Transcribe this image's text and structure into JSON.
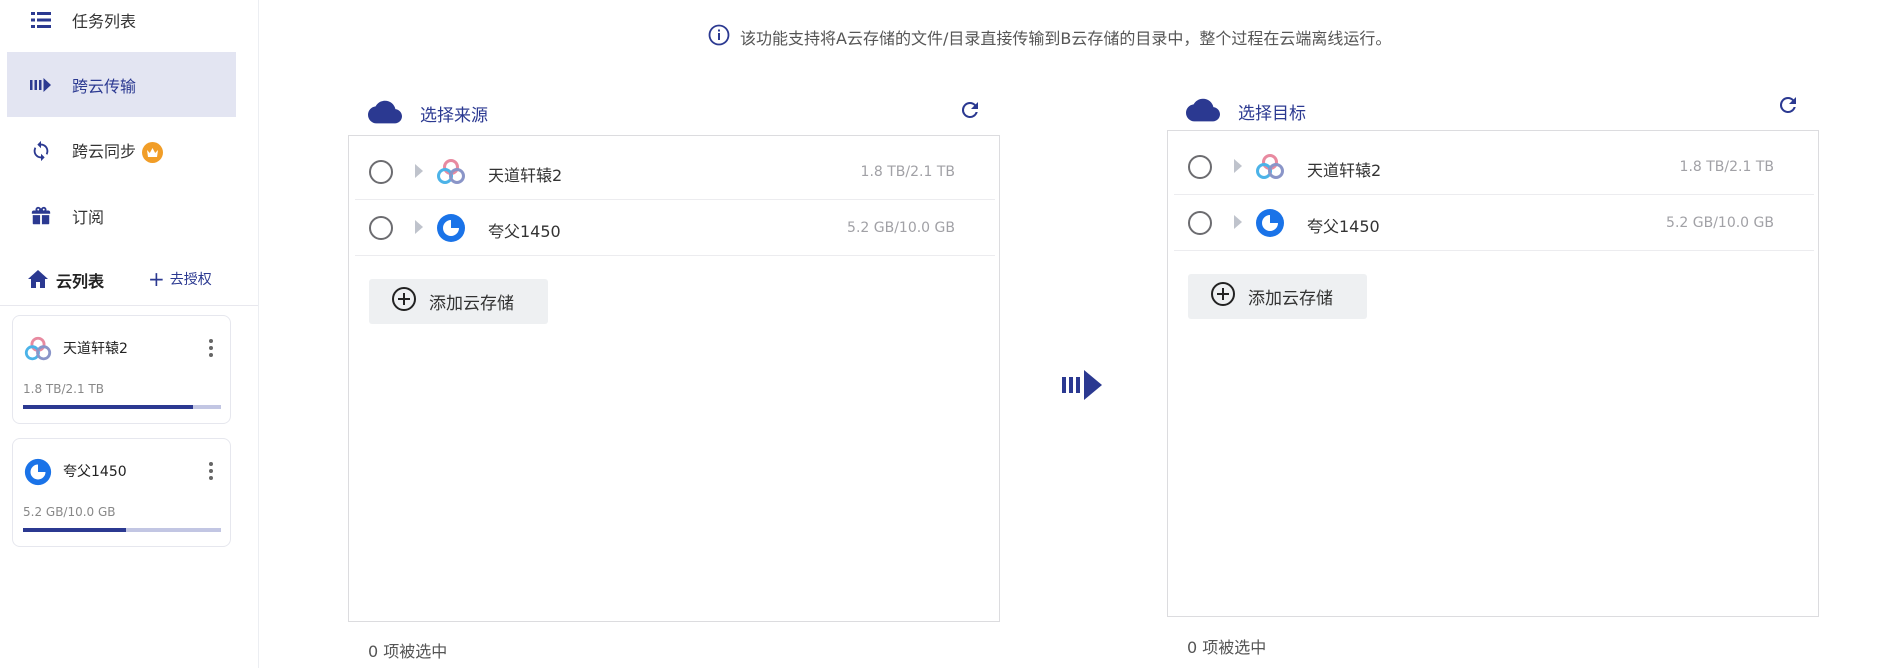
{
  "sidebar": {
    "nav": [
      {
        "label": "任务列表",
        "icon": "list-icon"
      },
      {
        "label": "跨云传输",
        "icon": "transfer-icon",
        "active": true
      },
      {
        "label": "跨云同步",
        "icon": "sync-icon",
        "badge": "crown-icon"
      },
      {
        "label": "订阅",
        "icon": "gift-icon"
      }
    ],
    "cloud_list": {
      "title": "云列表",
      "authorize_label": "去授权"
    },
    "storages": [
      {
        "name": "天道轩辕2",
        "usage": "1.8 TB/2.1 TB",
        "used_fraction": 0.857,
        "icon": "cloud-rings-icon"
      },
      {
        "name": "夸父1450",
        "usage": "5.2 GB/10.0 GB",
        "used_fraction": 0.52,
        "icon": "blue-drive-icon"
      }
    ]
  },
  "main": {
    "info_text": "该功能支持将A云存储的文件/目录直接传输到B云存储的目录中，整个过程在云端离线运行。",
    "source": {
      "title": "选择来源",
      "items": [
        {
          "name": "天道轩辕2",
          "size": "1.8 TB/2.1 TB"
        },
        {
          "name": "夸父1450",
          "size": "5.2 GB/10.0 GB"
        }
      ],
      "add_label": "添加云存储",
      "selected_text": "0 项被选中"
    },
    "target": {
      "title": "选择目标",
      "items": [
        {
          "name": "天道轩辕2",
          "size": "1.8 TB/2.1 TB"
        },
        {
          "name": "夸父1450",
          "size": "5.2 GB/10.0 GB"
        }
      ],
      "add_label": "添加云存储",
      "selected_text": "0 项被选中"
    }
  },
  "colors": {
    "accent": "#2b3991",
    "active_bg": "#e3e5f2",
    "crown": "#f19d27",
    "bar_track": "#c2c6e3"
  }
}
